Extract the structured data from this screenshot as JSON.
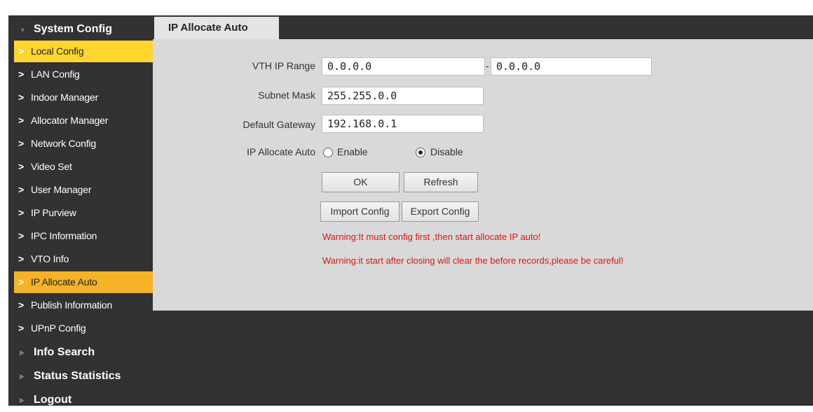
{
  "sidebar": {
    "section": "System Config",
    "items": [
      {
        "label": "Local Config"
      },
      {
        "label": "LAN Config"
      },
      {
        "label": "Indoor Manager"
      },
      {
        "label": "Allocator Manager"
      },
      {
        "label": "Network Config"
      },
      {
        "label": "Video Set"
      },
      {
        "label": "User Manager"
      },
      {
        "label": "IP Purview"
      },
      {
        "label": "IPC Information"
      },
      {
        "label": "VTO Info"
      },
      {
        "label": "IP Allocate Auto"
      },
      {
        "label": "Publish Information"
      },
      {
        "label": "UPnP Config"
      }
    ],
    "bottom": [
      {
        "label": "Info Search"
      },
      {
        "label": "Status Statistics"
      },
      {
        "label": "Logout"
      }
    ]
  },
  "tab": {
    "label": "IP Allocate Auto"
  },
  "form": {
    "vth_range_label": "VTH IP Range",
    "vth_range_start": "0.0.0.0",
    "vth_range_sep": "-",
    "vth_range_end": "0.0.0.0",
    "subnet_label": "Subnet Mask",
    "subnet_value": "255.255.0.0",
    "gateway_label": "Default Gateway",
    "gateway_value": "192.168.0.1",
    "auto_label": "IP Allocate Auto",
    "enable_label": "Enable",
    "disable_label": "Disable",
    "selected": "Disable"
  },
  "buttons": {
    "ok": "OK",
    "refresh": "Refresh",
    "import": "Import Config",
    "export": "Export Config"
  },
  "warnings": [
    "Warning:It must config first ,then start allocate IP auto!",
    "Warning:it start after closing will clear the before records,please be careful!"
  ],
  "colors": {
    "active_item": "#f5b327",
    "highlight_item": "#ffd62e",
    "warning": "#e01414",
    "frame": "#323232"
  }
}
